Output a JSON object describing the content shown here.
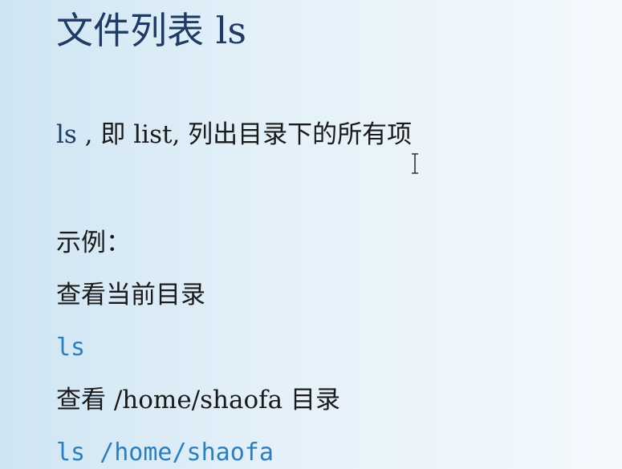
{
  "slide": {
    "title": "文件列表 ls",
    "description": {
      "command": "ls",
      "text": " , 即 list, 列出目录下的所有项"
    },
    "example_label": "示例：",
    "examples": [
      {
        "caption": "查看当前目录",
        "code": "ls"
      },
      {
        "caption": "查看 /home/shaofa 目录",
        "code": "ls /home/shaofa"
      }
    ]
  },
  "colors": {
    "title": "#1f3b63",
    "code": "#2a7fc1",
    "text": "#1a1a1a"
  },
  "icons": {
    "cursor": "text-cursor-icon"
  }
}
